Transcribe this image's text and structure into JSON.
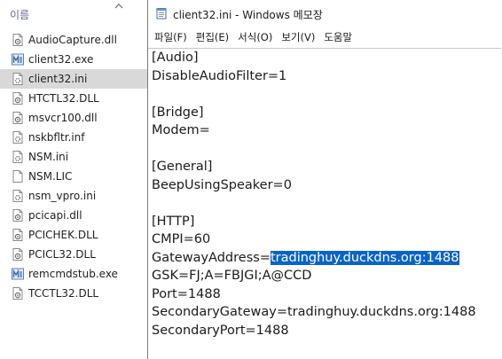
{
  "explorer": {
    "column_header": "이름",
    "files": [
      {
        "name": "AudioCapture.dll",
        "icon": "dll-file-icon",
        "selected": false
      },
      {
        "name": "client32.exe",
        "icon": "exe-app-icon",
        "selected": false
      },
      {
        "name": "client32.ini",
        "icon": "ini-settings-file-icon",
        "selected": true
      },
      {
        "name": "HTCTL32.DLL",
        "icon": "dll-file-icon",
        "selected": false
      },
      {
        "name": "msvcr100.dll",
        "icon": "dll-file-icon",
        "selected": false
      },
      {
        "name": "nskbfltr.inf",
        "icon": "inf-settings-file-icon",
        "selected": false
      },
      {
        "name": "NSM.ini",
        "icon": "ini-settings-file-icon",
        "selected": false
      },
      {
        "name": "NSM.LIC",
        "icon": "blank-file-icon",
        "selected": false
      },
      {
        "name": "nsm_vpro.ini",
        "icon": "ini-settings-file-icon",
        "selected": false
      },
      {
        "name": "pcicapi.dll",
        "icon": "dll-file-icon",
        "selected": false
      },
      {
        "name": "PCICHEK.DLL",
        "icon": "dll-file-icon",
        "selected": false
      },
      {
        "name": "PCICL32.DLL",
        "icon": "dll-file-icon",
        "selected": false
      },
      {
        "name": "remcmdstub.exe",
        "icon": "exe-app-icon",
        "selected": false
      },
      {
        "name": "TCCTL32.DLL",
        "icon": "dll-file-icon",
        "selected": false
      }
    ]
  },
  "notepad": {
    "title": "client32.ini - Windows 메모장",
    "menu": [
      "파일(F)",
      "편집(E)",
      "서식(O)",
      "보기(V)",
      "도움말"
    ],
    "lines": [
      {
        "text": "[Audio]"
      },
      {
        "text": "DisableAudioFilter=1"
      },
      {
        "text": ""
      },
      {
        "text": "[Bridge]"
      },
      {
        "text": "Modem="
      },
      {
        "text": ""
      },
      {
        "text": "[General]"
      },
      {
        "text": "BeepUsingSpeaker=0"
      },
      {
        "text": ""
      },
      {
        "text": "[HTTP]"
      },
      {
        "text": "CMPI=60"
      },
      {
        "text": "GatewayAddress=",
        "selected": "tradinghuy.duckdns.org:1488"
      },
      {
        "text": "GSK=FJ;A=FBJGI;A@CCD"
      },
      {
        "text": "Port=1488"
      },
      {
        "text": "SecondaryGateway=tradinghuy.duckdns.org:1488"
      },
      {
        "text": "SecondaryPort=1488"
      }
    ]
  },
  "colors": {
    "selection": "#0a64c8",
    "explorer_selected_row": "#d9d9d9",
    "header_text": "#5a6b8c"
  }
}
